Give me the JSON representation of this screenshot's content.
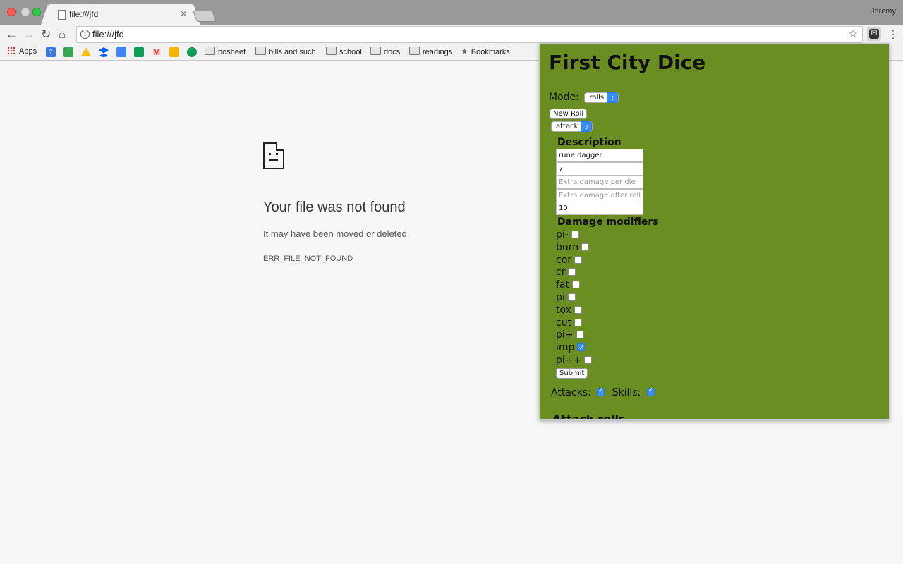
{
  "browser": {
    "tab_title": "file:///jfd",
    "tab_close": "×",
    "user": "Jeremy",
    "url": "file:///jfd",
    "nav": {
      "back": "←",
      "forward": "→",
      "reload": "↻",
      "home": "⌂"
    },
    "info_glyph": "i",
    "star": "☆",
    "menu": "⋮",
    "extension_glyph": "⚄"
  },
  "bookmarks": {
    "apps": "Apps",
    "bosheet": "bosheet",
    "bills": "bills and such",
    "school": "school",
    "docs": "docs",
    "readings": "readings",
    "bookmarks": "Bookmarks",
    "icon_colors": {
      "calendar": "#3b78e7",
      "maps": "#34a853",
      "drive": "#fbbc05",
      "dropbox": "#0061ff",
      "docs": "#4285f4",
      "sheets": "#0f9d58",
      "gmail": "#d93025",
      "keep": "#f4b400",
      "hangouts": "#0f9d58"
    },
    "calendar_day": "7",
    "gmail_letter": "M"
  },
  "error_page": {
    "title": "Your file was not found",
    "subtitle": "It may have been moved or deleted.",
    "code": "ERR_FILE_NOT_FOUND"
  },
  "popup": {
    "bg_color": "#6b8e23",
    "title": "First City Dice",
    "mode_label": "Mode:",
    "mode_value": "rolls",
    "new_roll": "New Roll",
    "roll_type": "attack",
    "description_heading": "Description",
    "fields": {
      "description": "rune dagger",
      "dice": "7",
      "extra_per_die_placeholder": "Extra damage per die",
      "extra_after_roll_placeholder": "Extra damage after roll",
      "last": "10"
    },
    "modifiers_heading": "Damage modifiers",
    "modifiers": [
      {
        "label": "pi-",
        "checked": false
      },
      {
        "label": "burn",
        "checked": false
      },
      {
        "label": "cor",
        "checked": false
      },
      {
        "label": "cr",
        "checked": false
      },
      {
        "label": "fat",
        "checked": false
      },
      {
        "label": "pi",
        "checked": false
      },
      {
        "label": "tox",
        "checked": false
      },
      {
        "label": "cut",
        "checked": false
      },
      {
        "label": "pi+",
        "checked": false
      },
      {
        "label": "imp",
        "checked": true
      },
      {
        "label": "pi++",
        "checked": false
      }
    ],
    "submit": "Submit",
    "attacks_label": "Attacks:",
    "attacks_checked": true,
    "skills_label": "Skills:",
    "skills_checked": true,
    "cut_heading": "Attack rolls"
  }
}
